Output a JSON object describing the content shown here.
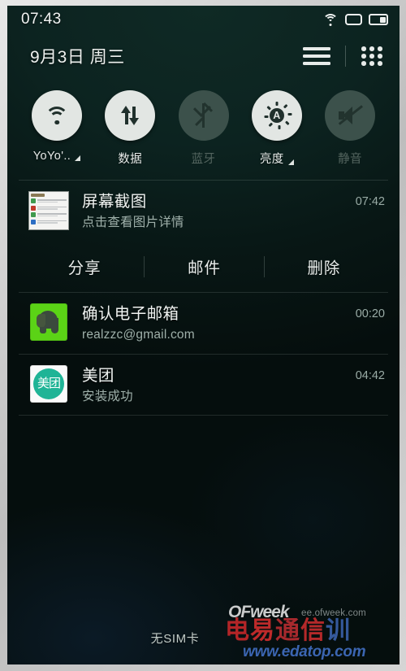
{
  "statusbar": {
    "clock": "07:43",
    "icons": [
      {
        "name": "wifi-icon",
        "label": "wifi"
      },
      {
        "name": "sim-icon",
        "label": "sim"
      },
      {
        "name": "battery-icon",
        "label": "battery"
      }
    ]
  },
  "header": {
    "date": "9月3日 周三",
    "list_view_icon": "list-icon",
    "grid_view_icon": "grid-icon"
  },
  "quick_settings": [
    {
      "id": "wifi",
      "label": "YoYo'..",
      "icon": "wifi-icon",
      "state": "on",
      "expandable": true
    },
    {
      "id": "data",
      "label": "数据",
      "icon": "data-sync-icon",
      "state": "on",
      "expandable": false
    },
    {
      "id": "bluetooth",
      "label": "蓝牙",
      "icon": "bluetooth-icon",
      "state": "off",
      "expandable": false
    },
    {
      "id": "brightness",
      "label": "亮度",
      "icon": "brightness-auto-icon",
      "state": "on",
      "expandable": true,
      "auto_letter": "A"
    },
    {
      "id": "mute",
      "label": "静音",
      "icon": "mute-icon",
      "state": "off",
      "expandable": false
    }
  ],
  "notifications": [
    {
      "id": "screenshot",
      "icon": "screenshot-thumbnail",
      "title": "屏幕截图",
      "subtitle": "点击查看图片详情",
      "time": "07:42",
      "actions": [
        {
          "id": "share",
          "label": "分享"
        },
        {
          "id": "email",
          "label": "邮件"
        },
        {
          "id": "delete",
          "label": "删除"
        }
      ]
    },
    {
      "id": "evernote",
      "icon": "evernote-app-icon",
      "title": "确认电子邮箱",
      "subtitle": "realzzc@gmail.com",
      "time": "00:20",
      "actions": []
    },
    {
      "id": "meituan",
      "icon": "meituan-app-icon",
      "icon_text": "美团",
      "title": "美团",
      "subtitle": "安装成功",
      "time": "04:42",
      "actions": []
    }
  ],
  "footer": {
    "no_sim": "无SIM卡"
  },
  "watermark": {
    "ofweek": "OFweek",
    "ofweek_url": "ee.ofweek.com",
    "cn": [
      "电",
      "易",
      "通",
      "信",
      "训"
    ],
    "edatop": "www.edatop.com"
  },
  "colors": {
    "background_top": "#0c2320",
    "background_bottom": "#050e0d",
    "tile_on": "#e2e6e3",
    "tile_off": "#3c514b",
    "evernote_green": "#5bd316",
    "meituan_teal": "#1fb496",
    "text_primary": "#f0f3f1",
    "text_secondary": "#9fb0aa"
  }
}
